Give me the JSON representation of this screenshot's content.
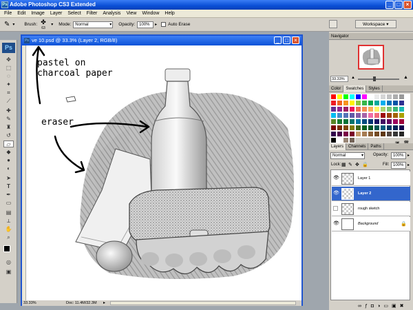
{
  "app": {
    "title": "Adobe Photoshop CS3 Extended",
    "minimize": "_",
    "maximize": "□",
    "close": "×"
  },
  "menu": [
    "File",
    "Edit",
    "Image",
    "Layer",
    "Select",
    "Filter",
    "Analysis",
    "View",
    "Window",
    "Help"
  ],
  "options": {
    "brush_label": "Brush:",
    "brush_size": "63",
    "mode_label": "Mode:",
    "mode_value": "Normal",
    "opacity_label": "Opacity:",
    "opacity_value": "100%",
    "auto_erase": "Auto Erase",
    "workspace": "Workspace ▾"
  },
  "document": {
    "title": "ve 10.psd @ 33.3% (Layer 2, RGB/8)",
    "zoom": "33.33%",
    "doc_size": "Doc: 11.4M/32.3M",
    "annotations": {
      "pastel": "pastel on\ncharcoal paper",
      "eraser": "eraser"
    }
  },
  "navigator": {
    "title": "Navigator",
    "zoom": "33.33%"
  },
  "swatches": {
    "tabs": [
      "Color",
      "Swatches",
      "Styles"
    ],
    "colors": [
      "#ff0000",
      "#ffff00",
      "#00ff00",
      "#00ffff",
      "#0000ff",
      "#ff00ff",
      "#ffffff",
      "#ebebeb",
      "#d6d6d6",
      "#c2c2c2",
      "#adadad",
      "#999999",
      "#ee1d24",
      "#f16522",
      "#f7941d",
      "#fff200",
      "#8dc63f",
      "#39b54a",
      "#00a651",
      "#00a99d",
      "#00aeef",
      "#0072bc",
      "#0054a6",
      "#2e3192",
      "#662d91",
      "#92278f",
      "#9e1f63",
      "#ed145b",
      "#f26c4f",
      "#f68e55",
      "#fbaf5c",
      "#fff467",
      "#acd372",
      "#7cc576",
      "#3bb878",
      "#1abbb4",
      "#00bff3",
      "#438ccb",
      "#5574b9",
      "#605ca8",
      "#855fa8",
      "#a763a8",
      "#f06eaa",
      "#f26d7d",
      "#9e0b0f",
      "#a0410d",
      "#a36209",
      "#aba000",
      "#598527",
      "#1a7b30",
      "#007236",
      "#00746b",
      "#0076a3",
      "#004a80",
      "#003471",
      "#1b1464",
      "#440e62",
      "#630460",
      "#9e005d",
      "#9e0039",
      "#790000",
      "#7b2e00",
      "#7d4900",
      "#827b00",
      "#406618",
      "#005e20",
      "#005826",
      "#005952",
      "#005b7f",
      "#003663",
      "#002157",
      "#0d004c",
      "#32004b",
      "#4b0049",
      "#7b0046",
      "#7a0026",
      "#c69c6d",
      "#a67c52",
      "#8c6239",
      "#754c24",
      "#603913",
      "#534741",
      "#363636",
      "#252525",
      "#000000",
      "#ffffff",
      "#998675",
      "#736357"
    ]
  },
  "layers": {
    "tabs": [
      "Layers",
      "Channels",
      "Paths"
    ],
    "blend_mode": "Normal",
    "opacity_label": "Opacity:",
    "opacity": "100%",
    "lock_label": "Lock:",
    "fill_label": "Fill:",
    "fill": "100%",
    "items": [
      {
        "name": "Layer 1",
        "visible": true,
        "selected": false
      },
      {
        "name": "Layer 2",
        "visible": true,
        "selected": true
      },
      {
        "name": "rough sketch",
        "visible": false,
        "selected": false
      },
      {
        "name": "Background",
        "visible": true,
        "selected": false
      }
    ],
    "footer_icons": [
      "link-icon",
      "fx-icon",
      "mask-icon",
      "adjustment-icon",
      "folder-icon",
      "new-layer-icon",
      "trash-icon"
    ]
  }
}
